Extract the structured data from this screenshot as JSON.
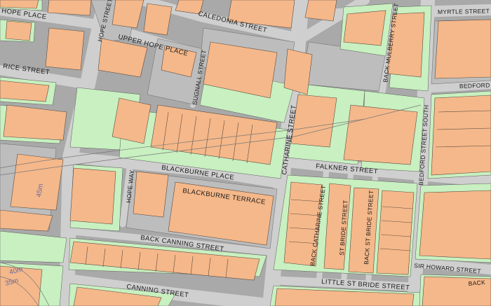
{
  "map": {
    "background_color": "#a9a9a9",
    "colors": {
      "building": "#f5b88a",
      "green": "#c8f0c0",
      "road": "#cfcfcf",
      "grey_block": "#bdbdbd",
      "contour": "#6a6aa0"
    },
    "street_labels": {
      "hope_place": "HOPE PLACE",
      "caledonia_street": "CALEDONIA STREET",
      "myrtle_street": "MYRTLE STREET",
      "hope_street": "HOPE STREET",
      "upper_hope_place": "UPPER HOPE PLACE",
      "rice_street": "RICE STREET",
      "back_mulberry_street": "BACK MULBERRY STREET",
      "bedford": "BEDFORD",
      "sugnall_street": "SUGNALL STREET",
      "catharine_street": "CATHARINE STREET",
      "falkner_street": "FALKNER STREET",
      "bedford_street_south": "BEDFORD STREET SOUTH",
      "blackburne_place": "BLACKBURNE PLACE",
      "hope_way": "HOPE WAY",
      "blackburne_terrace": "BLACKBURNE TERRACE",
      "back_catharine_street": "BACK CATHARINE STREET",
      "st_bride_street": "ST BRIDE STREET",
      "back_st_bride_street": "BACK ST BRIDE STREET",
      "back_canning_street": "BACK CANNING STREET",
      "sir_howard_street": "SIR HOWARD STREET",
      "back_edge": "BACK",
      "little_st_bride_street": "LITTLE ST BRIDE STREET",
      "canning_street": "CANNING STREET"
    },
    "contour_labels": {
      "c45": "45m",
      "c40": "40m",
      "c35": "35m"
    }
  }
}
